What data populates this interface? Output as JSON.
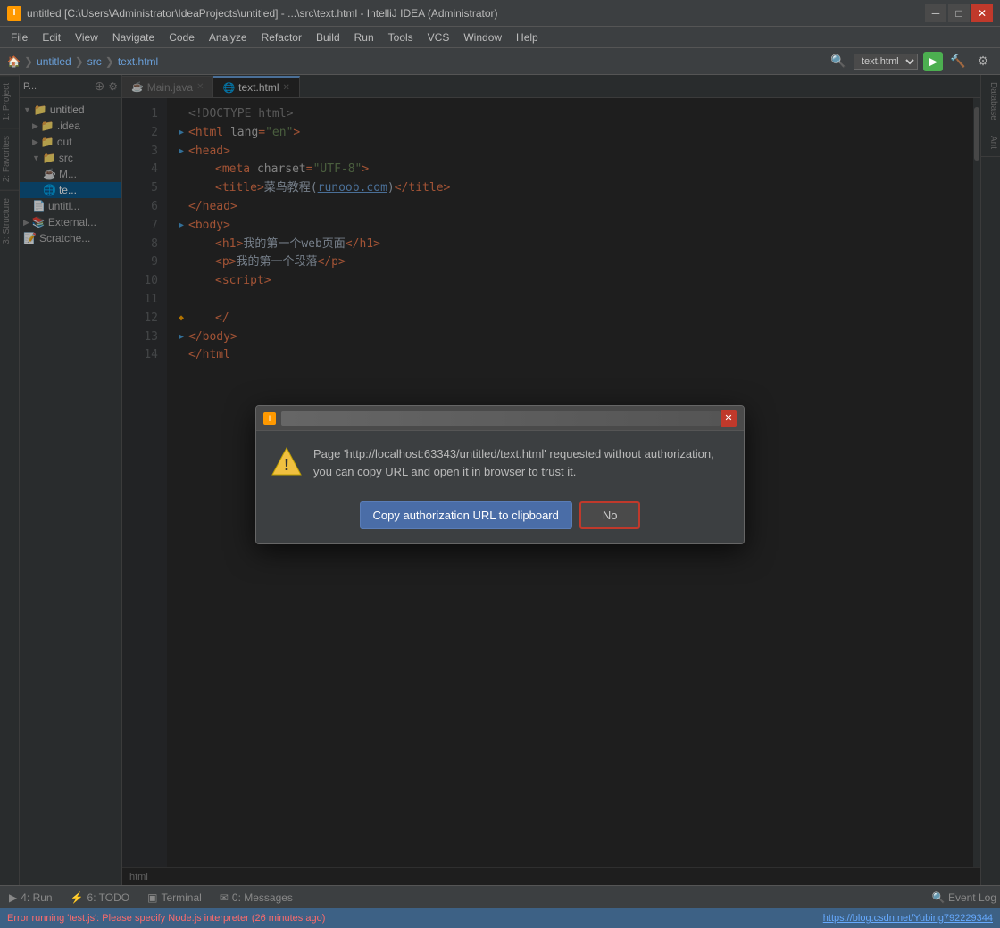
{
  "titleBar": {
    "icon": "I",
    "text": "untitled [C:\\Users\\Administrator\\IdeaProjects\\untitled] - ...\\src\\text.html - IntelliJ IDEA (Administrator)",
    "buttons": [
      "minimize",
      "maximize",
      "close"
    ]
  },
  "menuBar": {
    "items": [
      "File",
      "Edit",
      "View",
      "Navigate",
      "Code",
      "Analyze",
      "Refactor",
      "Build",
      "Run",
      "Tools",
      "VCS",
      "Window",
      "Help"
    ]
  },
  "toolbar": {
    "breadcrumb": [
      "untitled",
      "src",
      "text.html"
    ],
    "fileDropdown": "text.html"
  },
  "sidebar": {
    "tab": "P...",
    "tree": [
      {
        "level": 0,
        "label": "untitled",
        "icon": "📁",
        "expanded": true
      },
      {
        "level": 1,
        "label": ".idea",
        "icon": "📁"
      },
      {
        "level": 1,
        "label": "out",
        "icon": "📁",
        "expanded": false
      },
      {
        "level": 1,
        "label": "src",
        "icon": "📁",
        "expanded": true
      },
      {
        "level": 2,
        "label": "M...",
        "icon": "☕"
      },
      {
        "level": 2,
        "label": "te...",
        "icon": "🌐",
        "active": true
      },
      {
        "level": 1,
        "label": "untitl...",
        "icon": "📄"
      },
      {
        "level": 0,
        "label": "External...",
        "icon": "📚"
      },
      {
        "level": 0,
        "label": "Scratche...",
        "icon": "📝"
      }
    ]
  },
  "editorTabs": [
    {
      "label": "Main.java",
      "icon": "java",
      "active": false
    },
    {
      "label": "text.html",
      "icon": "html",
      "active": true
    }
  ],
  "code": {
    "lines": [
      {
        "num": 1,
        "gutter": "",
        "content": "<!DOCTYPE html>"
      },
      {
        "num": 2,
        "gutter": "▶",
        "content": "<html lang=\"en\">"
      },
      {
        "num": 3,
        "gutter": "▶",
        "content": "<head>"
      },
      {
        "num": 4,
        "gutter": "",
        "content": "    <meta charset=\"UTF-8\">"
      },
      {
        "num": 5,
        "gutter": "",
        "content": "    <title>菜鸟教程(runoob.com)</title>"
      },
      {
        "num": 6,
        "gutter": "",
        "content": "</head>"
      },
      {
        "num": 7,
        "gutter": "▶",
        "content": "<body>"
      },
      {
        "num": 8,
        "gutter": "",
        "content": "    <h1>我的第一个web页面</h1>"
      },
      {
        "num": 9,
        "gutter": "",
        "content": "    <p>我的第一个段落</p>"
      },
      {
        "num": 10,
        "gutter": "",
        "content": "    <script>"
      },
      {
        "num": 11,
        "gutter": "",
        "content": ""
      },
      {
        "num": 12,
        "gutter": "◆",
        "content": "    </"
      },
      {
        "num": 13,
        "gutter": "▶",
        "content": "</body>"
      },
      {
        "num": 14,
        "gutter": "",
        "content": "</html"
      }
    ]
  },
  "dialog": {
    "title": "",
    "closeBtn": "✕",
    "message": "Page 'http://localhost:63343/untitled/text.html' requested without authorization, you can copy URL and open it in browser to trust it.",
    "copyBtn": "Copy authorization URL to clipboard",
    "noBtn": "No"
  },
  "bottomTabs": [
    {
      "icon": "▶",
      "label": "4: Run"
    },
    {
      "icon": "⚡",
      "label": "6: TODO"
    },
    {
      "icon": "▣",
      "label": "Terminal"
    },
    {
      "icon": "✉",
      "label": "0: Messages"
    }
  ],
  "statusBar": {
    "error": "Error running 'test.js': Please specify Node.js interpreter (26 minutes ago)",
    "right": "https://blog.csdn.net/Yubing792229344",
    "htmlLabel": "html"
  },
  "rightPanels": [
    "Database",
    "Ant"
  ],
  "leftLabels": [
    "1: Project",
    "2: Favorites",
    "3: Structure"
  ]
}
